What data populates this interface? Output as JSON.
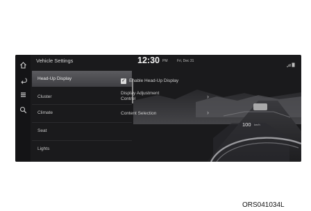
{
  "header": {
    "title": "Vehicle Settings",
    "time": "12:30",
    "ampm": "PM",
    "date": "Fri, Dec 31"
  },
  "menu": {
    "items": [
      {
        "label": "Head-Up Display",
        "selected": true
      },
      {
        "label": "Cluster",
        "selected": false
      },
      {
        "label": "Climate",
        "selected": false
      },
      {
        "label": "Seat",
        "selected": false
      },
      {
        "label": "Lights",
        "selected": false
      }
    ]
  },
  "options": {
    "enable_label": "Enable Head-Up Display",
    "enable_checked": true,
    "adjust_line1": "Display Adjustment",
    "adjust_line2": "Control",
    "content_label": "Content Selection"
  },
  "hud": {
    "speed": "100",
    "unit": "km/h"
  },
  "icons": [
    "home-icon",
    "back-icon",
    "menu-icon",
    "search-icon",
    "signal-icon"
  ],
  "caption": "ORS041034L"
}
